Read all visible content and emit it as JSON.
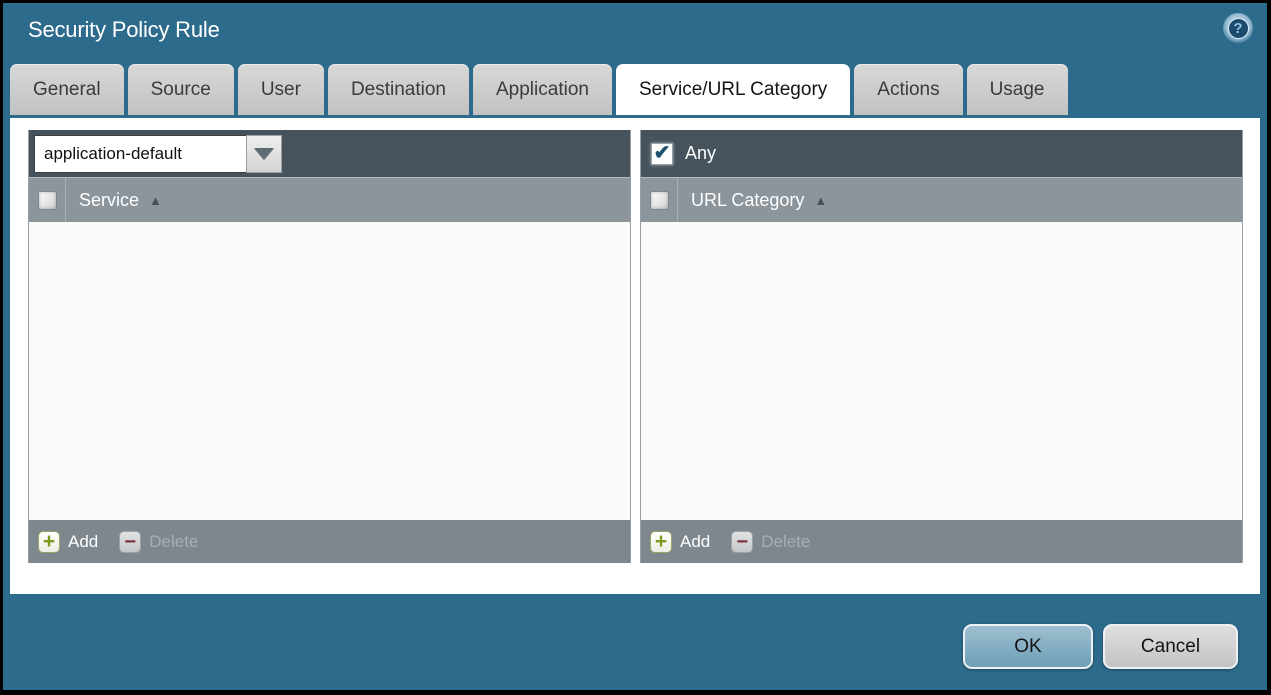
{
  "window": {
    "title": "Security Policy Rule"
  },
  "icons": {
    "help": "?",
    "check": "✔",
    "plus": "+",
    "minus": "−",
    "sort_asc": "▲"
  },
  "tabs": [
    {
      "label": "General",
      "active": false
    },
    {
      "label": "Source",
      "active": false
    },
    {
      "label": "User",
      "active": false
    },
    {
      "label": "Destination",
      "active": false
    },
    {
      "label": "Application",
      "active": false
    },
    {
      "label": "Service/URL Category",
      "active": true
    },
    {
      "label": "Actions",
      "active": false
    },
    {
      "label": "Usage",
      "active": false
    }
  ],
  "service_panel": {
    "dropdown_value": "application-default",
    "column_header": "Service",
    "rows": [],
    "add_label": "Add",
    "delete_label": "Delete",
    "delete_enabled": false
  },
  "url_category_panel": {
    "any_label": "Any",
    "any_checked": true,
    "column_header": "URL Category",
    "rows": [],
    "add_label": "Add",
    "delete_label": "Delete",
    "delete_enabled": false
  },
  "dialog_buttons": {
    "ok_label": "OK",
    "cancel_label": "Cancel"
  },
  "colors": {
    "background_teal": "#2d6b8c",
    "titlebar_text": "#ffffff",
    "panel_bar_dark": "#46535c",
    "column_header_gray": "#8c959b",
    "footer_gray": "#7e878e",
    "add_plus_green": "#7d9b1d",
    "delete_minus_red": "#7c3136",
    "ok_button_blue": "#7ba7bd",
    "cancel_button_gray": "#c9c9c9",
    "active_tab_white": "#ffffff",
    "inactive_tab_gray": "#c9cac9"
  }
}
